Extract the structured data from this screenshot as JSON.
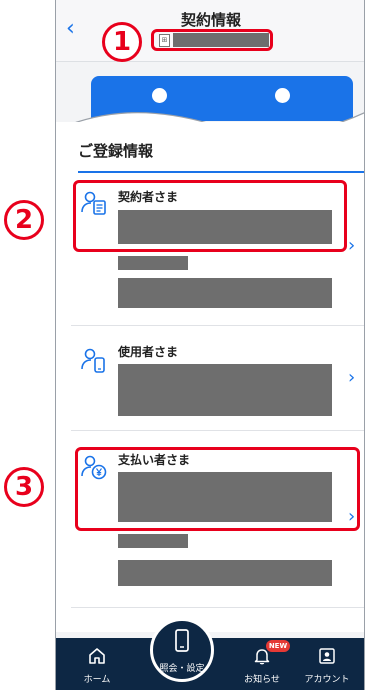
{
  "header": {
    "title": "契約情報",
    "sim_label": "⊞"
  },
  "section": {
    "title": "ご登録情報"
  },
  "rows": [
    {
      "label": "契約者さま"
    },
    {
      "label": "使用者さま"
    },
    {
      "label": "支払い者さま"
    }
  ],
  "tabbar": {
    "home": "ホーム",
    "inquiry": "照会・設定",
    "notice": "お知らせ",
    "notice_badge": "NEW",
    "account": "アカウント"
  },
  "annotations": {
    "one": "1",
    "two": "2",
    "three": "3"
  },
  "colors": {
    "accent": "#1a73e8",
    "tabbar": "#0d2744",
    "highlight": "#e8001c",
    "redaction": "#6e6e6e"
  }
}
